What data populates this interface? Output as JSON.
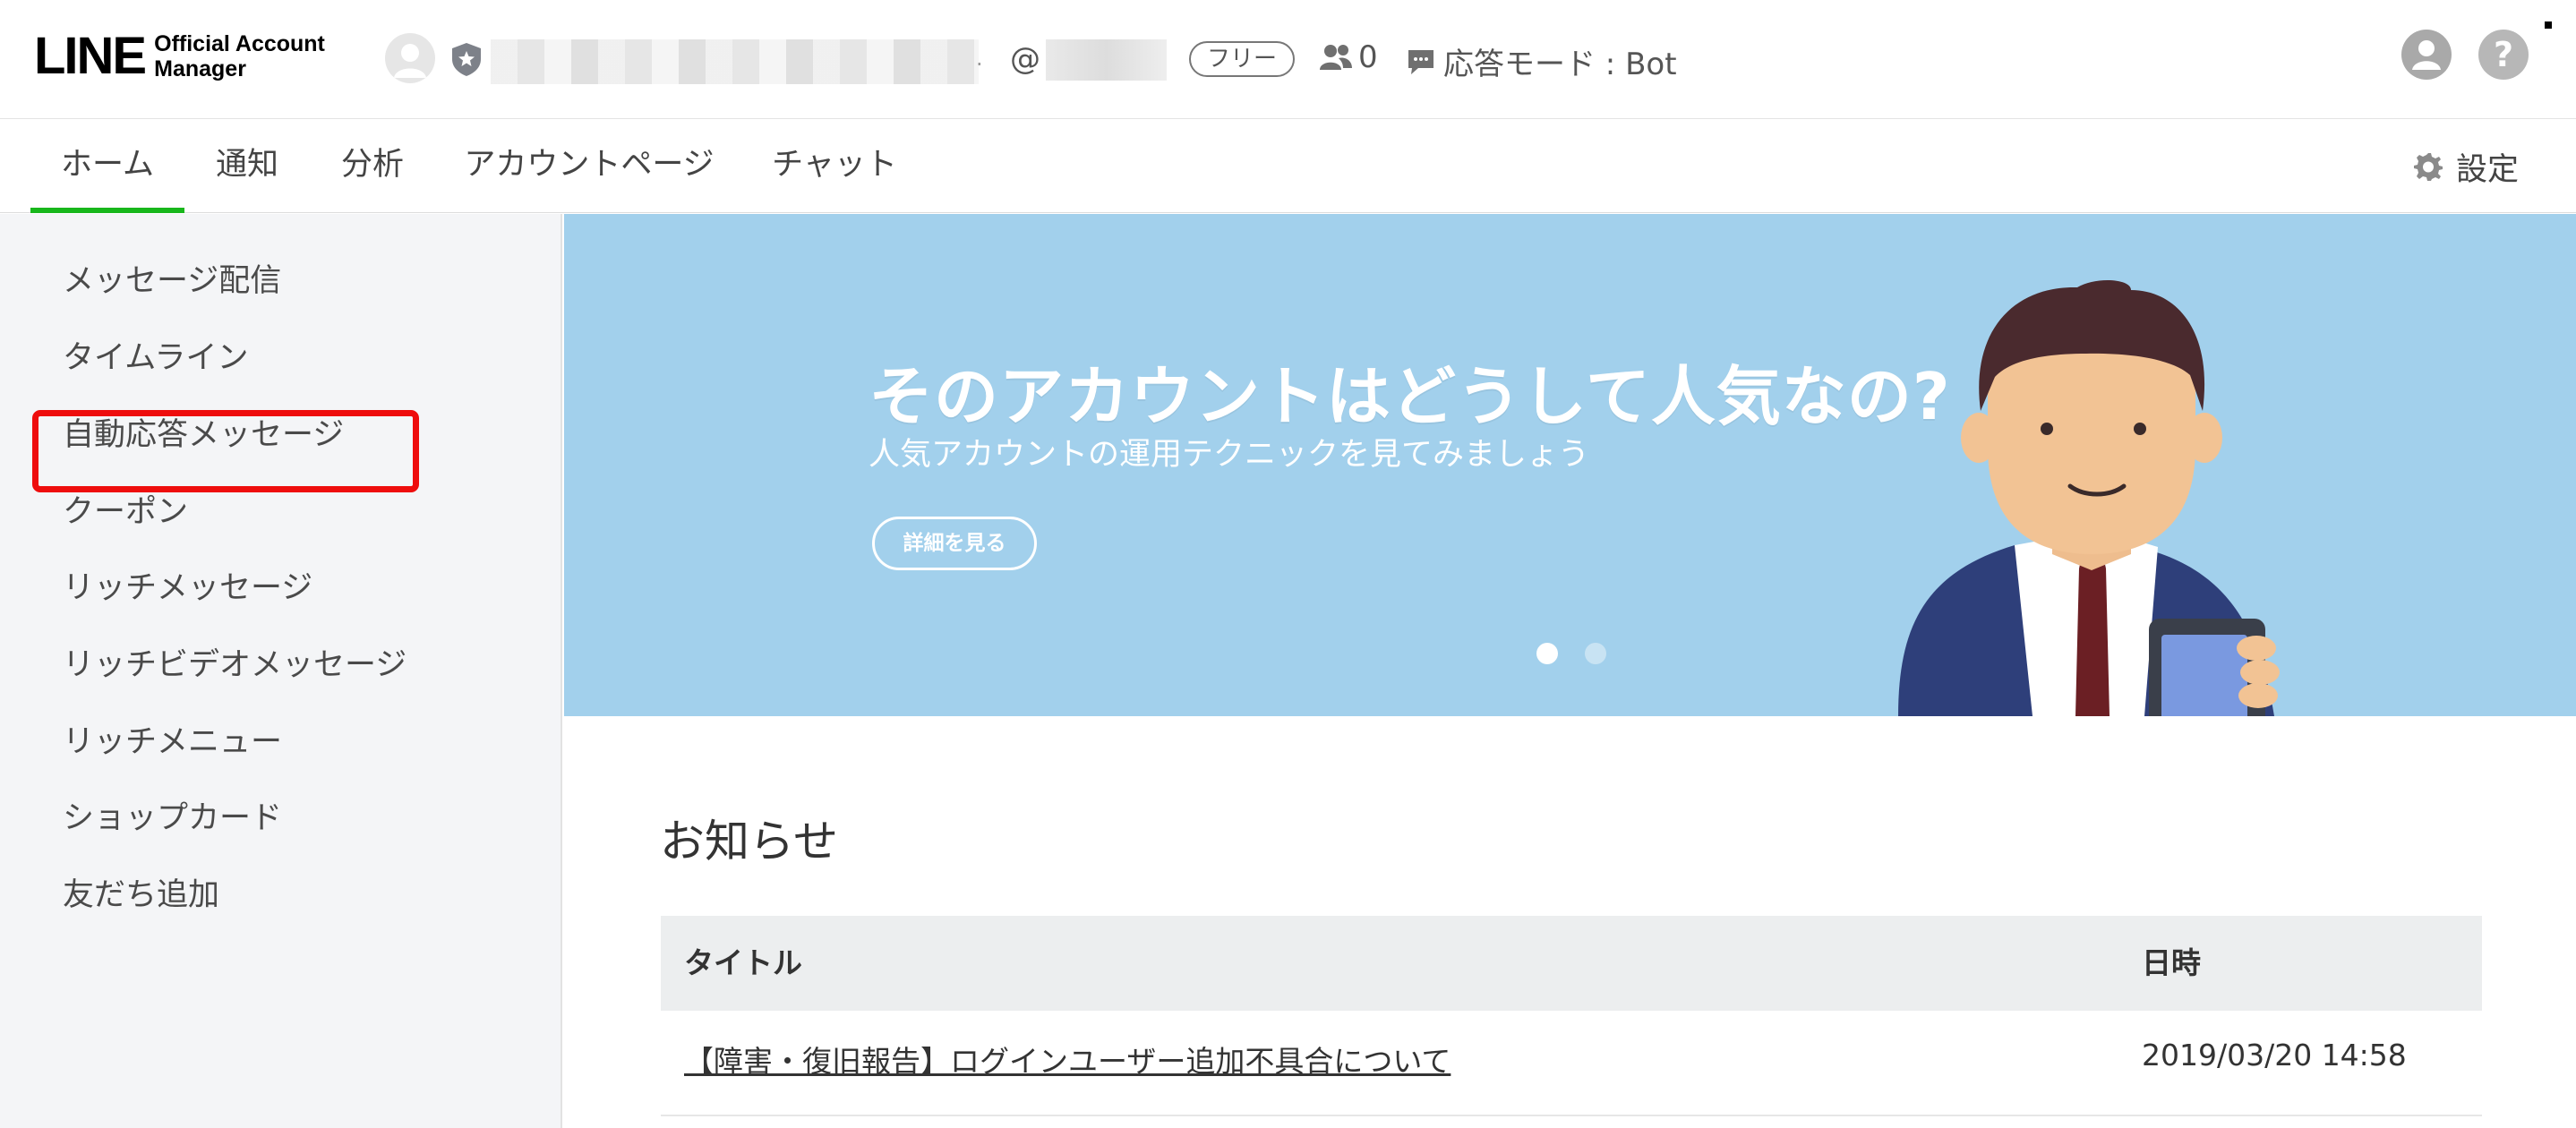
{
  "header": {
    "logo": {
      "line": "LINE",
      "sub_line1": "Official Account",
      "sub_line2": "Manager"
    },
    "account": {
      "name": "",
      "id_prefix": "@"
    },
    "plan_badge": "フリー",
    "friends_count": "0",
    "response_mode": "応答モード : Bot"
  },
  "nav": {
    "tabs": [
      {
        "label": "ホーム",
        "active": true
      },
      {
        "label": "通知",
        "active": false
      },
      {
        "label": "分析",
        "active": false
      },
      {
        "label": "アカウントページ",
        "active": false
      },
      {
        "label": "チャット",
        "active": false
      }
    ],
    "settings_label": "設定"
  },
  "sidebar": {
    "items": [
      {
        "label": "メッセージ配信"
      },
      {
        "label": "タイムライン"
      },
      {
        "label": "自動応答メッセージ",
        "highlighted": true
      },
      {
        "label": "クーポン"
      },
      {
        "label": "リッチメッセージ"
      },
      {
        "label": "リッチビデオメッセージ"
      },
      {
        "label": "リッチメニュー"
      },
      {
        "label": "ショップカード"
      },
      {
        "label": "友だち追加"
      }
    ]
  },
  "banner": {
    "title": "そのアカウントはどうして人気なの?",
    "subtitle": "人気アカウントの運用テクニックを見てみましょう",
    "button_label": "詳細を見る",
    "slide_count": 2,
    "active_slide": 1,
    "background_color": "#a2d0ec"
  },
  "notices": {
    "heading": "お知らせ",
    "columns": [
      "タイトル",
      "日時"
    ],
    "rows": [
      {
        "title": "【障害・復旧報告】ログインユーザー追加不具合について",
        "date": "2019/03/20 14:58"
      }
    ]
  },
  "colors": {
    "accent_green": "#18b71b",
    "highlight_red": "#ee0d0d"
  },
  "icons": [
    "user-avatar-icon",
    "shield-star-icon",
    "friends-icon",
    "chat-bubble-icon",
    "account-icon",
    "help-icon",
    "gear-icon"
  ]
}
